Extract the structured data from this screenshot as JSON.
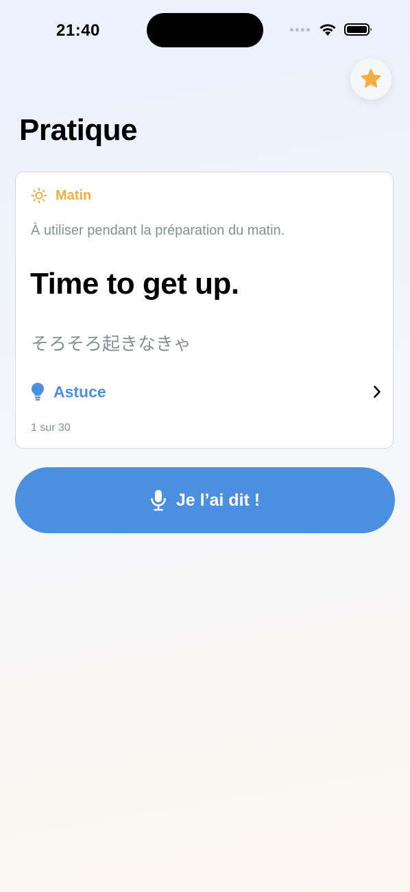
{
  "status_bar": {
    "time": "21:40"
  },
  "header": {
    "title": "Pratique",
    "favorite_icon": "star-icon",
    "favorite_color": "#f5ad3e"
  },
  "card": {
    "category": {
      "icon": "sun-icon",
      "label": "Matin",
      "color": "#f5ad3e"
    },
    "usage_hint": "À utiliser pendant la préparation du matin.",
    "phrase": "Time to get up.",
    "translation": "そろそろ起きなきゃ",
    "tip": {
      "icon": "lightbulb-icon",
      "label": "Astuce",
      "color": "#4a8fe0"
    },
    "counter": "1 sur 30"
  },
  "action_button": {
    "icon": "microphone-icon",
    "label": "Je l’ai dit !",
    "color": "#4a8fe0"
  }
}
